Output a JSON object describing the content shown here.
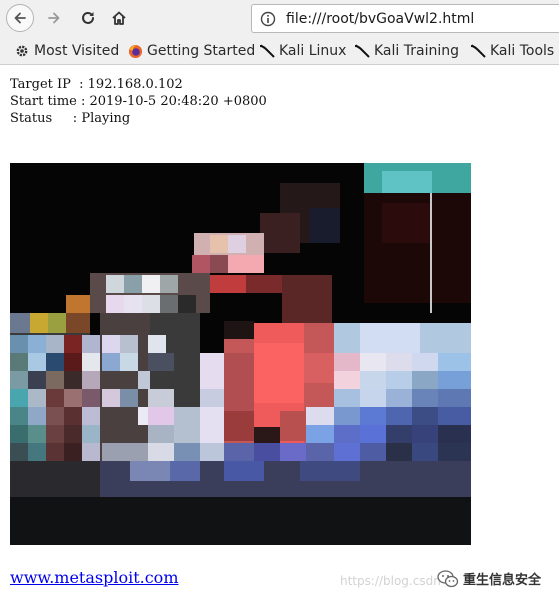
{
  "browser": {
    "url": "file:///root/bvGoaVwl2.html",
    "bookmarks": [
      {
        "label": "Most Visited",
        "icon": "gear-icon"
      },
      {
        "label": "Getting Started",
        "icon": "firefox-icon"
      },
      {
        "label": "Kali Linux",
        "icon": "kali-icon"
      },
      {
        "label": "Kali Training",
        "icon": "kali-icon"
      },
      {
        "label": "Kali Tools",
        "icon": "kali-icon"
      }
    ]
  },
  "page": {
    "lines": [
      "Target IP  : 192.168.0.102",
      "Start time : 2019-10-5 20:48:20 +0800",
      "Status     : Playing"
    ],
    "link": "www.metasploit.com"
  },
  "watermark": {
    "text": "https://blog.csdn",
    "brand": "重生信息安全"
  }
}
